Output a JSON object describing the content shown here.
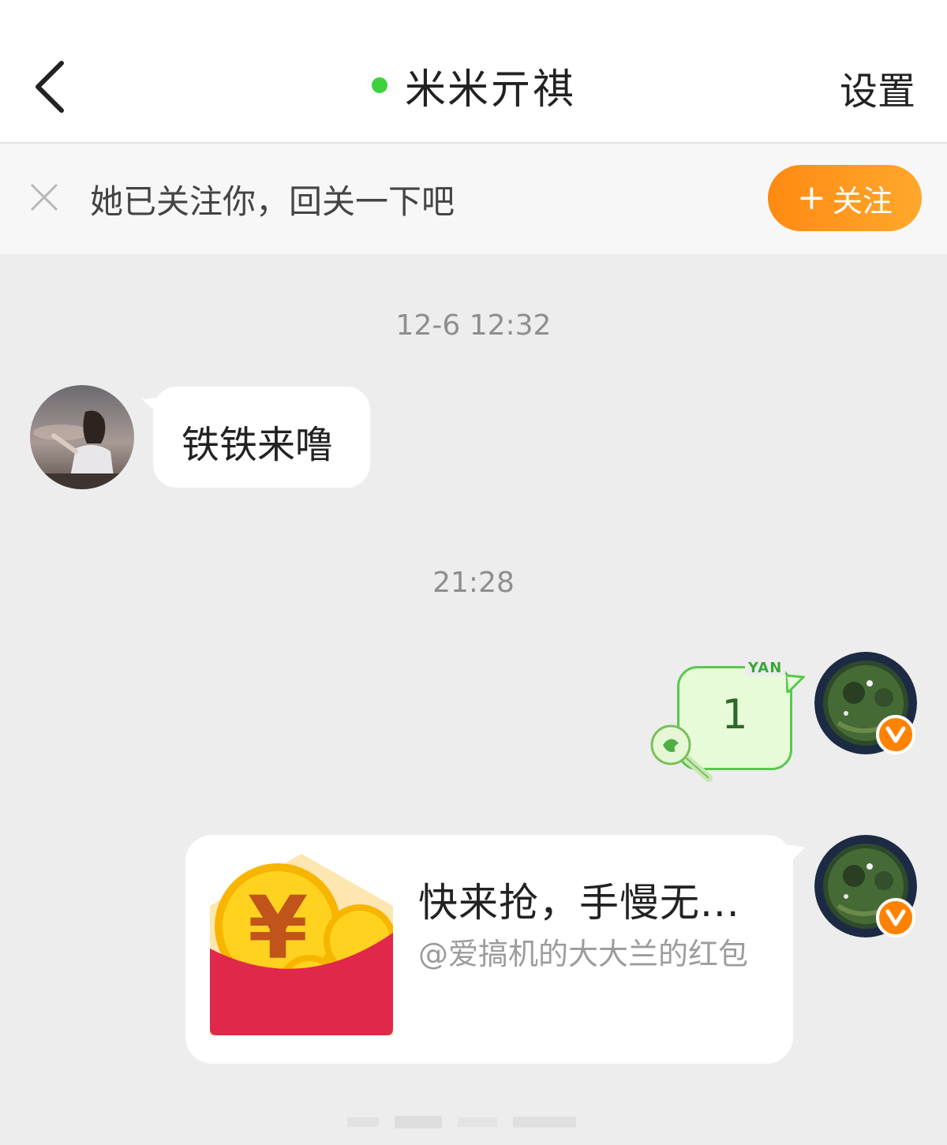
{
  "header": {
    "title": "米米亓祺",
    "settings_label": "设置",
    "online_color": "#3dd13d"
  },
  "follow_bar": {
    "text": "她已关注你，回关一下吧",
    "button_label": "关注",
    "button_color": "#ff8a12"
  },
  "chat": {
    "messages": [
      {
        "time": "12-6 12:32",
        "side": "left",
        "type": "text",
        "text": "铁铁来噜"
      },
      {
        "time": "21:28",
        "side": "right",
        "type": "sticker",
        "text": "1",
        "sticker_tag": "YAN"
      },
      {
        "side": "right",
        "type": "red-packet",
        "title": "快来抢，手慢无...",
        "subtitle": "@爱搞机的大大兰的红包"
      }
    ]
  },
  "icons": {
    "back": "chevron-left-icon",
    "close": "close-icon",
    "verified": "verified-v-badge-icon",
    "red_packet": "red-envelope-icon"
  }
}
